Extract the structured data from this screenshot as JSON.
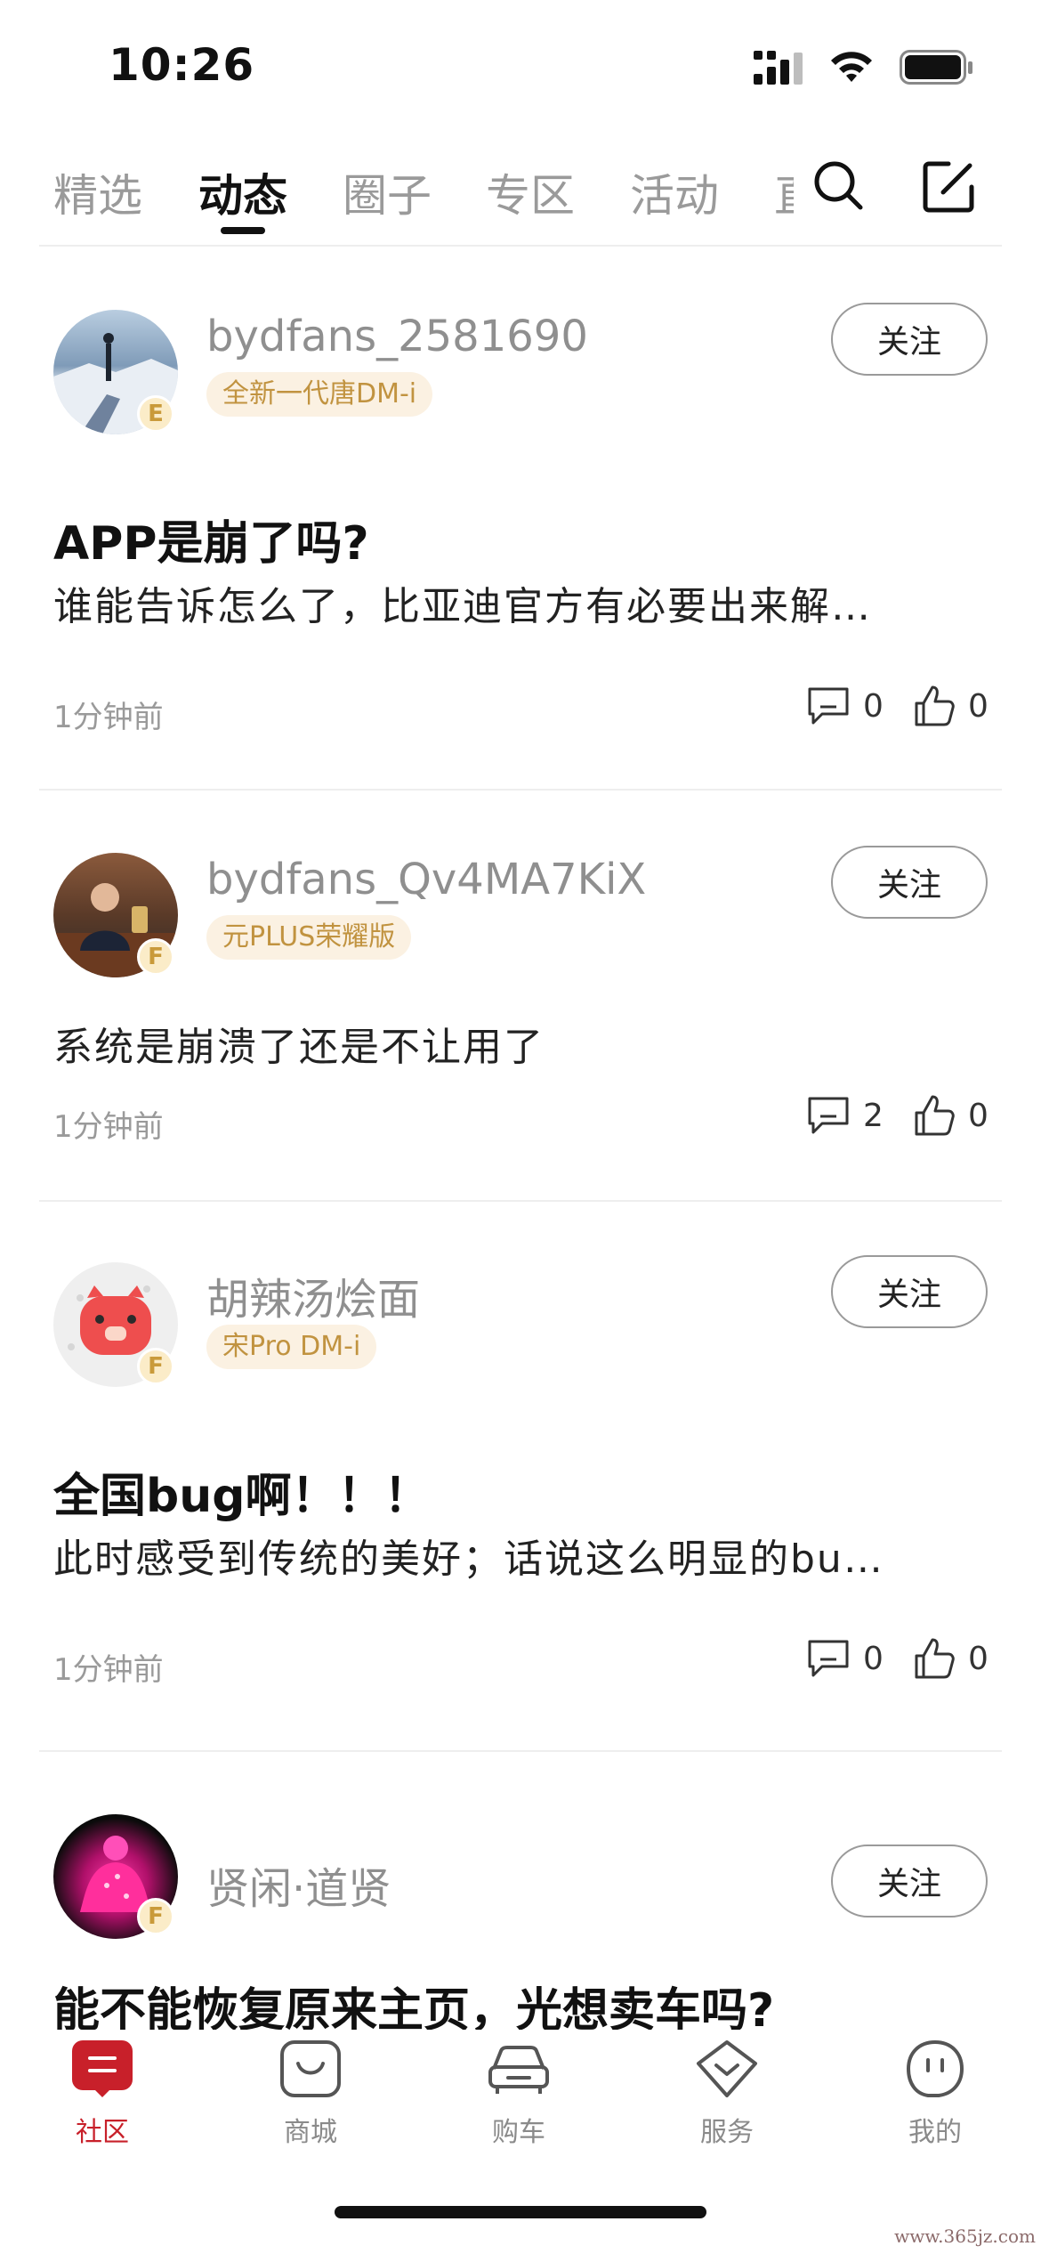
{
  "status_bar": {
    "time": "10:26"
  },
  "top_tabs": [
    {
      "label": "精选",
      "active": false
    },
    {
      "label": "动态",
      "active": true
    },
    {
      "label": "圈子",
      "active": false
    },
    {
      "label": "专区",
      "active": false
    },
    {
      "label": "活动",
      "active": false
    }
  ],
  "top_tabs_clipped": "直",
  "posts": [
    {
      "username": "bydfans_2581690",
      "car_tag": "全新一代唐DM-i",
      "level": "E",
      "follow_label": "关注",
      "title": "APP是崩了吗?",
      "body": "谁能告诉怎么了，比亚迪官方有必要出来解…",
      "time": "1分钟前",
      "comments": "0",
      "likes": "0"
    },
    {
      "username": "bydfans_Qv4MA7KiX",
      "car_tag": "元PLUS荣耀版",
      "level": "F",
      "follow_label": "关注",
      "title": "",
      "body": "系统是崩溃了还是不让用了",
      "time": "1分钟前",
      "comments": "2",
      "likes": "0"
    },
    {
      "username": "胡辣汤烩面",
      "car_tag": "宋Pro DM-i",
      "level": "F",
      "follow_label": "关注",
      "title": "全国bug啊！！！",
      "body": "此时感受到传统的美好；话说这么明显的bu…",
      "time": "1分钟前",
      "comments": "0",
      "likes": "0"
    },
    {
      "username": "贤闲·道贤",
      "car_tag": "",
      "level": "F",
      "follow_label": "关注",
      "title": "能不能恢复原来主页，光想卖车吗?",
      "body": "",
      "time": "",
      "comments": "",
      "likes": ""
    }
  ],
  "bottom_nav": [
    {
      "label": "社区",
      "icon": "community-icon",
      "active": true
    },
    {
      "label": "商城",
      "icon": "shop-icon",
      "active": false
    },
    {
      "label": "购车",
      "icon": "car-icon",
      "active": false
    },
    {
      "label": "服务",
      "icon": "service-icon",
      "active": false
    },
    {
      "label": "我的",
      "icon": "profile-icon",
      "active": false
    }
  ],
  "watermark": "www.365jz.com",
  "colors": {
    "accent": "#c8202a",
    "tag_bg": "#fbf1e2",
    "tag_text": "#c19340",
    "muted": "#9a9a9a"
  }
}
